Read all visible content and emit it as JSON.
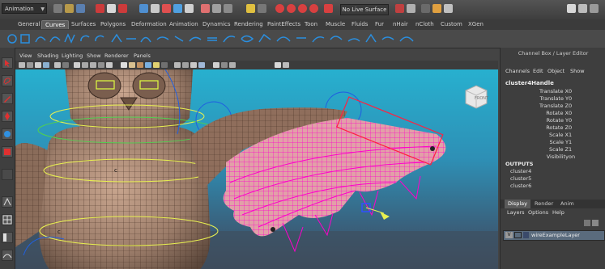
{
  "statusline": {
    "menu_set": "Animation",
    "live_surface": "No Live Surface"
  },
  "shelf_tabs": [
    "General",
    "Curves",
    "Surfaces",
    "Polygons",
    "Deformation",
    "Animation",
    "Dynamics",
    "Rendering",
    "PaintEffects",
    "Toon",
    "Muscle",
    "Fluids",
    "Fur",
    "nHair",
    "nCloth",
    "Custom",
    "XGen"
  ],
  "shelf_active": "Curves",
  "viewport": {
    "menu": [
      "View",
      "Shading",
      "Lighting",
      "Show",
      "Renderer",
      "Panels"
    ],
    "viewcube_label": "FRONT"
  },
  "channel_box": {
    "title": "Channel Box / Layer Editor",
    "menu": [
      "Channels",
      "Edit",
      "Object",
      "Show"
    ],
    "node": "cluster4Handle",
    "attributes": [
      {
        "name": "Translate X",
        "value": "0"
      },
      {
        "name": "Translate Y",
        "value": "0"
      },
      {
        "name": "Translate Z",
        "value": "0"
      },
      {
        "name": "Rotate X",
        "value": "0"
      },
      {
        "name": "Rotate Y",
        "value": "0"
      },
      {
        "name": "Rotate Z",
        "value": "0"
      },
      {
        "name": "Scale X",
        "value": "1"
      },
      {
        "name": "Scale Y",
        "value": "1"
      },
      {
        "name": "Scale Z",
        "value": "1"
      },
      {
        "name": "Visibility",
        "value": "on"
      }
    ],
    "outputs_label": "OUTPUTS",
    "outputs": [
      "cluster4",
      "cluster5",
      "cluster6"
    ]
  },
  "layer_editor": {
    "tabs": [
      "Display",
      "Render",
      "Anim"
    ],
    "menu": [
      "Layers",
      "Options",
      "Help"
    ],
    "layer": {
      "visible": "V",
      "name": "wireExampleLayer"
    }
  },
  "colors": {
    "wire_selected": "#ff00cc",
    "mesh_body": "#9c7d6a",
    "viewport_sky": "#27b0cf",
    "shelf_tab_active": "#5d5d5d"
  }
}
